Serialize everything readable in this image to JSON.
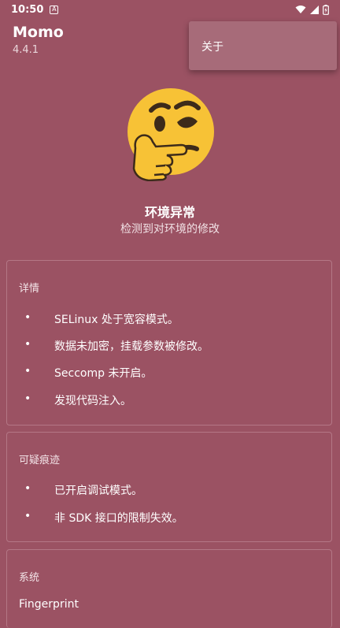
{
  "status_bar": {
    "time": "10:50",
    "notif_icon": "A"
  },
  "app": {
    "name": "Momo",
    "version": "4.4.1"
  },
  "menu": {
    "about_label": "关于"
  },
  "status": {
    "title": "环境异常",
    "subtitle": "检测到对环境的修改"
  },
  "details": {
    "title": "详情",
    "items": [
      "SELinux 处于宽容模式。",
      "数据未加密，挂载参数被修改。",
      "Seccomp 未开启。",
      "发现代码注入。"
    ]
  },
  "suspicious": {
    "title": "可疑痕迹",
    "items": [
      "已开启调试模式。",
      "非 SDK 接口的限制失效。"
    ]
  },
  "system": {
    "title": "系统",
    "fingerprint_label": "Fingerprint"
  },
  "bullet": "•",
  "colors": {
    "background": "#9b5263",
    "menu": "#a76b79",
    "card_border": "#b47786",
    "emoji": "#f7c236"
  }
}
